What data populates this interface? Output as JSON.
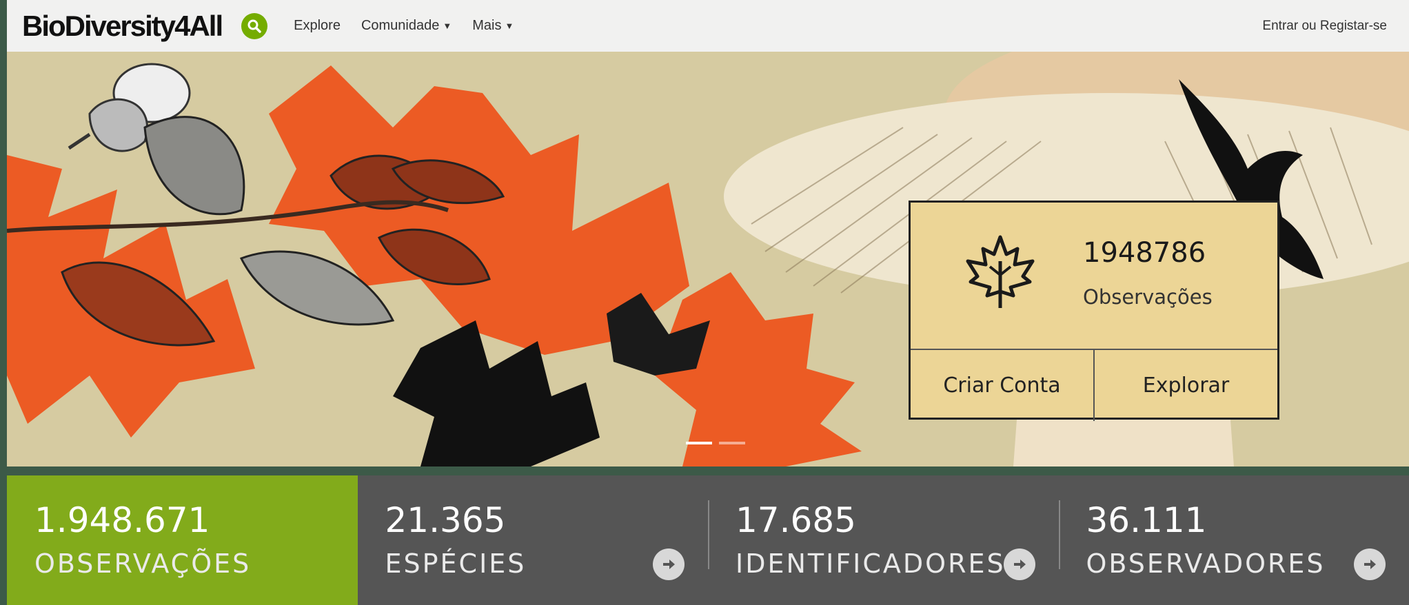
{
  "nav": {
    "logo": "BioDiversity4All",
    "links": [
      {
        "label": "Explore",
        "has_caret": false
      },
      {
        "label": "Comunidade",
        "has_caret": true
      },
      {
        "label": "Mais",
        "has_caret": true
      }
    ],
    "login": "Entrar ou Registar-se",
    "search_icon": "search-icon",
    "accent": "#74ac00"
  },
  "hero": {
    "count": "1948786",
    "count_label": "Observações",
    "icon": "maple-leaf-icon",
    "buttons": [
      "Criar Conta",
      "Explorar"
    ],
    "slides": 2,
    "active_slide": 1
  },
  "stats": [
    {
      "value": "1.948.671",
      "label": "OBSERVAÇÕES",
      "active": true
    },
    {
      "value": "21.365",
      "label": "ESPÉCIES",
      "active": false
    },
    {
      "value": "17.685",
      "label": "IDENTIFICADORES",
      "active": false
    },
    {
      "value": "36.111",
      "label": "OBSERVADORES",
      "active": false
    }
  ],
  "colors": {
    "stats_active": "#82ab1b",
    "stats_bg": "#555555",
    "hero_orange": "#ec5b24",
    "infobox_bg": "#ecd596"
  }
}
